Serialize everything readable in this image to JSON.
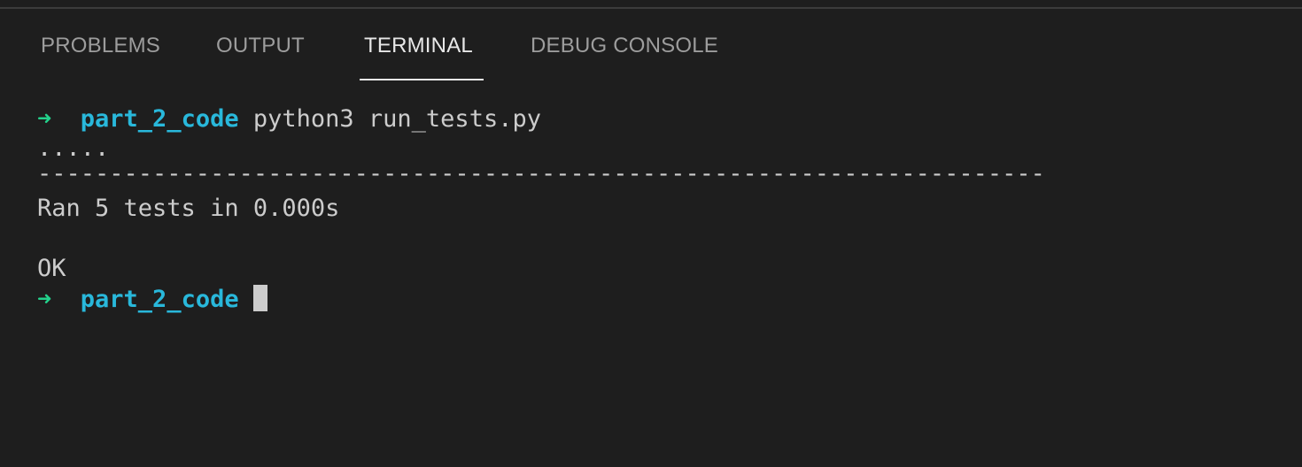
{
  "tabs": [
    {
      "label": "PROBLEMS"
    },
    {
      "label": "OUTPUT"
    },
    {
      "label": "TERMINAL"
    },
    {
      "label": "DEBUG CONSOLE"
    }
  ],
  "active_tab": "TERMINAL",
  "terminal": {
    "prompt_arrow": "➜",
    "cwd": "part_2_code",
    "command": "python3 run_tests.py",
    "dots": ".....",
    "separator": "----------------------------------------------------------------------",
    "ran_line": "Ran 5 tests in 0.000s",
    "result": "OK"
  },
  "colors": {
    "background": "#1e1e1e",
    "arrow": "#23d18b",
    "cwd": "#29b8db",
    "text": "#cccccc",
    "active_tab": "#e7e7e7",
    "inactive_tab": "#9d9d9d"
  }
}
